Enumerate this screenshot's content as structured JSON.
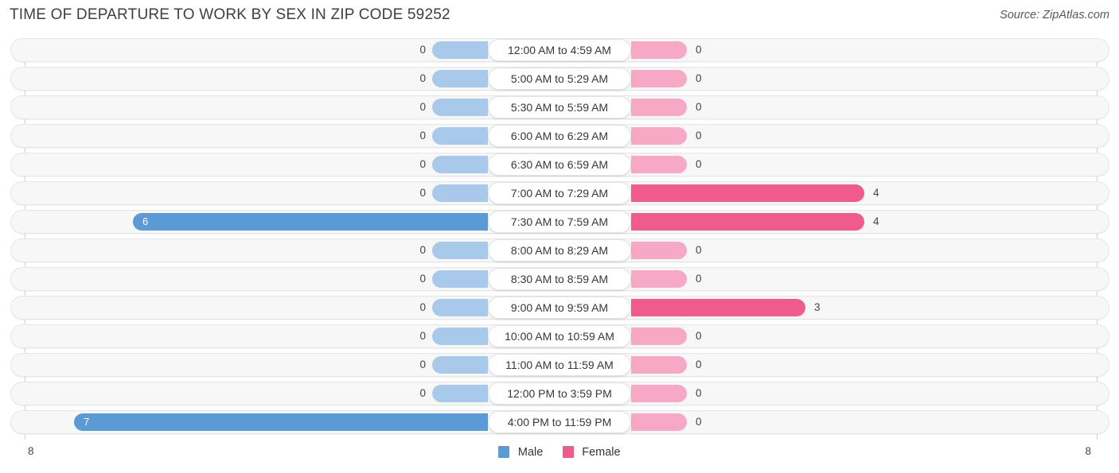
{
  "header": {
    "title": "TIME OF DEPARTURE TO WORK BY SEX IN ZIP CODE 59252",
    "source": "Source: ZipAtlas.com"
  },
  "legend": {
    "male": {
      "label": "Male",
      "color": "#5b9bd5"
    },
    "female": {
      "label": "Female",
      "color": "#ef5c8c"
    }
  },
  "axis": {
    "left_tick": "8",
    "right_tick": "8",
    "max": 8
  },
  "colors": {
    "male": "#5b9bd5",
    "male_zero": "#a9c9ea",
    "female": "#ef5c8c",
    "female_zero": "#f6a8c4",
    "row_background": "#f7f7f7",
    "title": "#3c4043"
  },
  "chart_data": {
    "type": "bar",
    "title": "TIME OF DEPARTURE TO WORK BY SEX IN ZIP CODE 59252",
    "subtitle": "",
    "xlabel": "",
    "ylabel": "",
    "orientation": "horizontal-diverging",
    "xlim": [
      0,
      8
    ],
    "grid": false,
    "legend_position": "bottom-center",
    "categories": [
      "12:00 AM to 4:59 AM",
      "5:00 AM to 5:29 AM",
      "5:30 AM to 5:59 AM",
      "6:00 AM to 6:29 AM",
      "6:30 AM to 6:59 AM",
      "7:00 AM to 7:29 AM",
      "7:30 AM to 7:59 AM",
      "8:00 AM to 8:29 AM",
      "8:30 AM to 8:59 AM",
      "9:00 AM to 9:59 AM",
      "10:00 AM to 10:59 AM",
      "11:00 AM to 11:59 AM",
      "12:00 PM to 3:59 PM",
      "4:00 PM to 11:59 PM"
    ],
    "series": [
      {
        "name": "Male",
        "values": [
          0,
          0,
          0,
          0,
          0,
          0,
          6,
          0,
          0,
          0,
          0,
          0,
          0,
          7
        ]
      },
      {
        "name": "Female",
        "values": [
          0,
          0,
          0,
          0,
          0,
          4,
          4,
          0,
          0,
          3,
          0,
          0,
          0,
          0
        ]
      }
    ]
  },
  "rows": [
    {
      "label": "12:00 AM to 4:59 AM",
      "male": "0",
      "female": "0"
    },
    {
      "label": "5:00 AM to 5:29 AM",
      "male": "0",
      "female": "0"
    },
    {
      "label": "5:30 AM to 5:59 AM",
      "male": "0",
      "female": "0"
    },
    {
      "label": "6:00 AM to 6:29 AM",
      "male": "0",
      "female": "0"
    },
    {
      "label": "6:30 AM to 6:59 AM",
      "male": "0",
      "female": "0"
    },
    {
      "label": "7:00 AM to 7:29 AM",
      "male": "0",
      "female": "4"
    },
    {
      "label": "7:30 AM to 7:59 AM",
      "male": "6",
      "female": "4"
    },
    {
      "label": "8:00 AM to 8:29 AM",
      "male": "0",
      "female": "0"
    },
    {
      "label": "8:30 AM to 8:59 AM",
      "male": "0",
      "female": "0"
    },
    {
      "label": "9:00 AM to 9:59 AM",
      "male": "0",
      "female": "3"
    },
    {
      "label": "10:00 AM to 10:59 AM",
      "male": "0",
      "female": "0"
    },
    {
      "label": "11:00 AM to 11:59 AM",
      "male": "0",
      "female": "0"
    },
    {
      "label": "12:00 PM to 3:59 PM",
      "male": "0",
      "female": "0"
    },
    {
      "label": "4:00 PM to 11:59 PM",
      "male": "7",
      "female": "0"
    }
  ]
}
